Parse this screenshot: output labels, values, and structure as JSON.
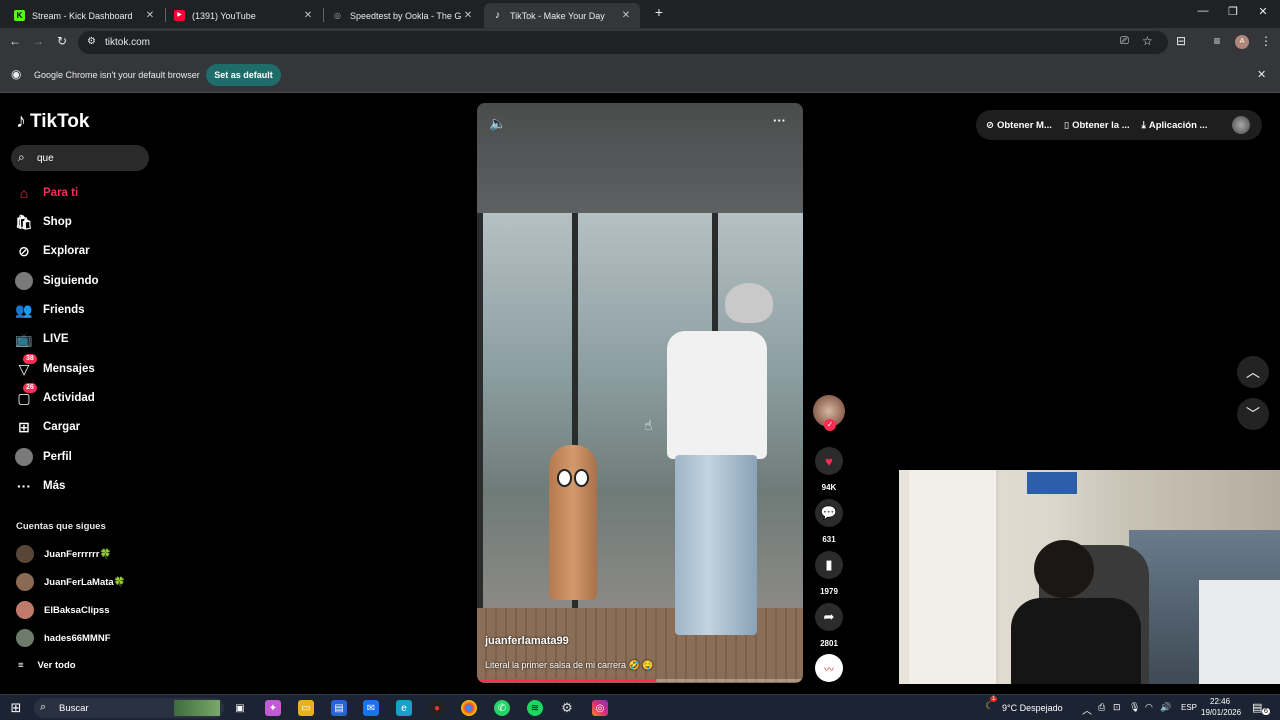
{
  "browser": {
    "tabs": [
      {
        "title": "Stream - Kick Dashboard",
        "favicon": "K",
        "favicon_color": "#53fc18",
        "active": false
      },
      {
        "title": "(1391) YouTube",
        "favicon": "▶",
        "favicon_color": "#ff0033",
        "active": false
      },
      {
        "title": "Speedtest by Ookla - The Glob",
        "favicon": "◎",
        "favicon_color": "#9aa0a6",
        "active": false
      },
      {
        "title": "TikTok - Make Your Day",
        "favicon": "♪",
        "favicon_color": "#ffffff",
        "active": true
      }
    ],
    "new_tab": "+",
    "url": "tiktok.com",
    "profile_initial": "A",
    "infobar_message": "Google Chrome isn't your default browser",
    "infobar_button": "Set as default"
  },
  "sidebar": {
    "logo_text": "TikTok",
    "search_value": "que",
    "nav": [
      {
        "label": "Para ti",
        "icon": "home-icon",
        "glyph": "⌂",
        "active": true
      },
      {
        "label": "Shop",
        "icon": "shop-icon",
        "glyph": "🛍",
        "active": false
      },
      {
        "label": "Explorar",
        "icon": "compass-icon",
        "glyph": "⊘",
        "active": false
      },
      {
        "label": "Siguiendo",
        "icon": "following-avatar-icon",
        "glyph": "●",
        "active": false
      },
      {
        "label": "Friends",
        "icon": "friends-icon",
        "glyph": "👥",
        "active": false
      },
      {
        "label": "LIVE",
        "icon": "live-icon",
        "glyph": "📺",
        "active": false
      },
      {
        "label": "Mensajes",
        "icon": "messages-icon",
        "glyph": "▽",
        "badge": "38",
        "active": false
      },
      {
        "label": "Actividad",
        "icon": "activity-icon",
        "glyph": "▢",
        "badge": "26",
        "active": false
      },
      {
        "label": "Cargar",
        "icon": "upload-icon",
        "glyph": "⊞",
        "active": false
      },
      {
        "label": "Perfil",
        "icon": "profile-avatar-icon",
        "glyph": "●",
        "active": false
      },
      {
        "label": "Más",
        "icon": "more-icon",
        "glyph": "···",
        "active": false
      }
    ],
    "following_title": "Cuentas que sigues",
    "following": [
      {
        "name": "JuanFerrrrrr🍀"
      },
      {
        "name": "JuanFerLaMata🍀"
      },
      {
        "name": "ElBaksaClipss"
      },
      {
        "name": "hades66MMNF"
      }
    ],
    "see_all": "Ver todo"
  },
  "video": {
    "author": "juanferlamata99",
    "caption": "Literal la primer salsa de mi carrera 🤣 🤤",
    "progress": 0.55,
    "menu": "···"
  },
  "actions": {
    "likes": "94K",
    "comments": "631",
    "saves": "1979",
    "shares": "2801"
  },
  "topbar": {
    "items": [
      "Obtener M...",
      "Obtener la ...",
      "Aplicación ..."
    ]
  },
  "taskbar": {
    "search_label": "Buscar",
    "weather": "9°C  Despejado",
    "lang": "ESP",
    "time": "22:46",
    "date": "19/01/2026",
    "notif_count": "6",
    "weather_badge": "1"
  },
  "colors": {
    "accent": "#fe2c55",
    "chrome_dark": "#202124",
    "chrome_toolbar": "#35363a",
    "taskbar": "#1c2433"
  }
}
